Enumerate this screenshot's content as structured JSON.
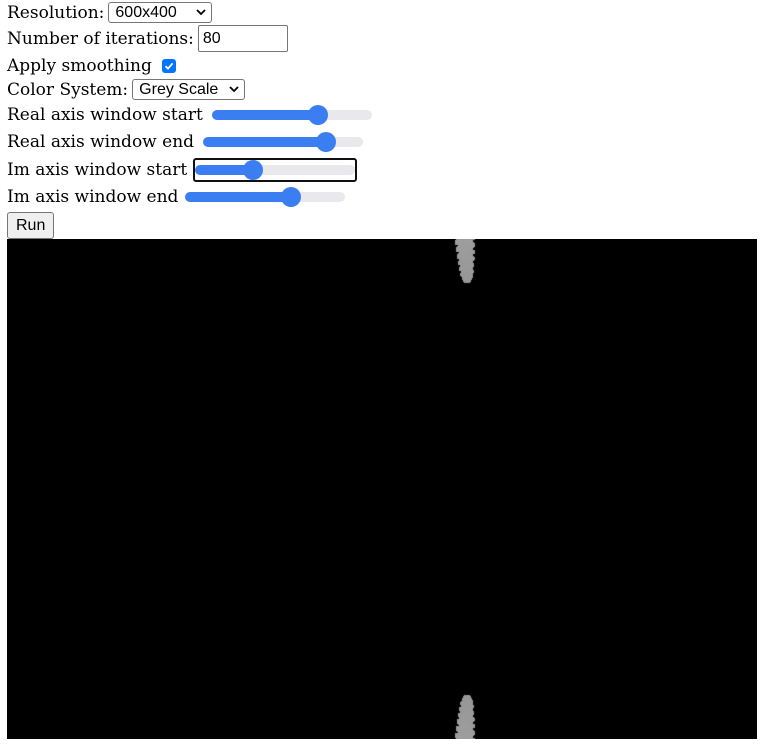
{
  "controls": {
    "resolution": {
      "label": "Resolution:",
      "value": "600x400"
    },
    "iterations": {
      "label": "Number of iterations:",
      "value": "80"
    },
    "smoothing": {
      "label": "Apply smoothing",
      "checked": true
    },
    "color_system": {
      "label": "Color System:",
      "value": "Grey Scale"
    },
    "real_start": {
      "label": "Real axis window start",
      "level": 0.69
    },
    "real_end": {
      "label": "Real axis window end",
      "level": 0.81
    },
    "im_start": {
      "label": "Im axis window start",
      "level": 0.34
    },
    "im_end": {
      "label": "Im axis window end",
      "level": 0.68
    },
    "run_label": "Run"
  },
  "colors": {
    "accent": "#3b7ef2",
    "track": "#e9e9ed",
    "checkbox": "#0075ff"
  },
  "canvas": {
    "color_scheme": "greyscale"
  }
}
